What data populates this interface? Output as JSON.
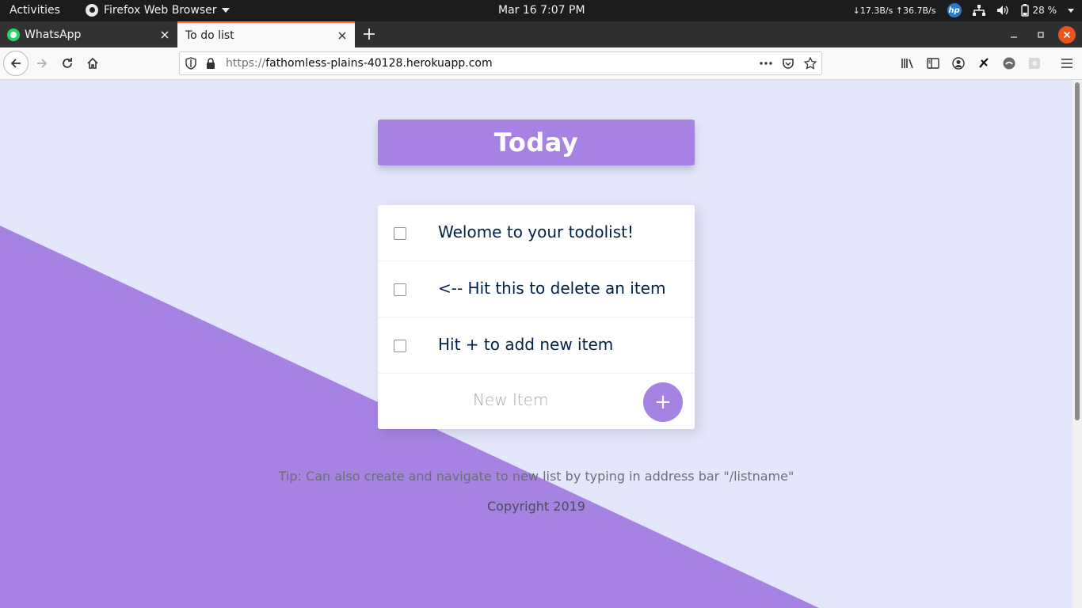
{
  "topbar": {
    "activities": "Activities",
    "app_name": "Firefox Web Browser",
    "clock": "Mar 16  7:07 PM",
    "net_speed": "↓17.3B/s ↑36.7B/s",
    "hp_label": "hp",
    "battery": "28 %"
  },
  "tabs": [
    {
      "title": "WhatsApp"
    },
    {
      "title": "To do list"
    }
  ],
  "navbar": {
    "url_scheme": "https://",
    "url_host": "fathomless-plains-40128.herokuapp.com"
  },
  "page": {
    "heading": "Today",
    "items": [
      {
        "text": "Welome to your todolist!",
        "checked": false
      },
      {
        "text": "<-- Hit this to delete an item",
        "checked": false
      },
      {
        "text": "Hit + to add new item",
        "checked": false
      }
    ],
    "new_item_placeholder": "New Item",
    "add_button": "+",
    "tip": "Tip: Can also create and navigate to new list by typing in address bar \"/listname\"",
    "copyright": "Copyright 2019"
  },
  "colors": {
    "accent": "#a683e3",
    "background": "#e4e6fb",
    "item_text": "#00204a"
  }
}
